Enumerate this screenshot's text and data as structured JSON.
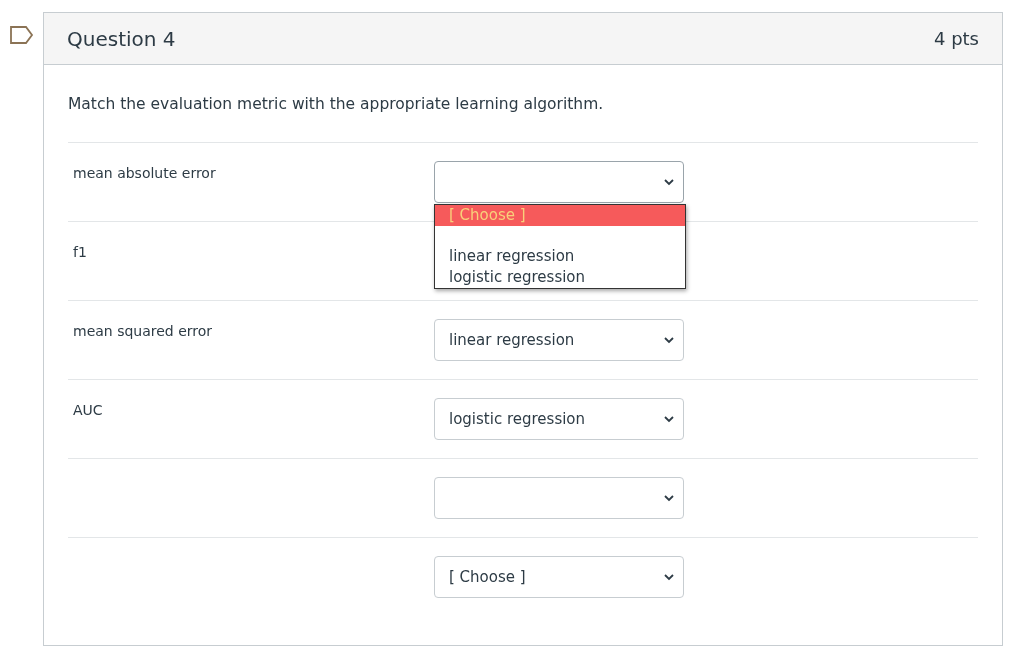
{
  "question": {
    "title": "Question 4",
    "points": "4 pts",
    "prompt": "Match the evaluation metric with the appropriate learning algorithm."
  },
  "rows": [
    {
      "label": "mean absolute error",
      "open": true,
      "menu": [
        {
          "kind": "option",
          "label": "[ Choose ]",
          "selected": true
        },
        {
          "kind": "blank"
        },
        {
          "kind": "option",
          "label": "linear regression",
          "selected": false
        },
        {
          "kind": "option",
          "label": "logistic regression",
          "selected": false
        }
      ]
    },
    {
      "label": "f1",
      "open": false
    },
    {
      "label": "mean squared error",
      "value": "linear regression",
      "open": false
    },
    {
      "label": "AUC",
      "value": "logistic regression",
      "open": false
    },
    {
      "open": false
    },
    {
      "value": "[ Choose ]",
      "open": false
    }
  ]
}
